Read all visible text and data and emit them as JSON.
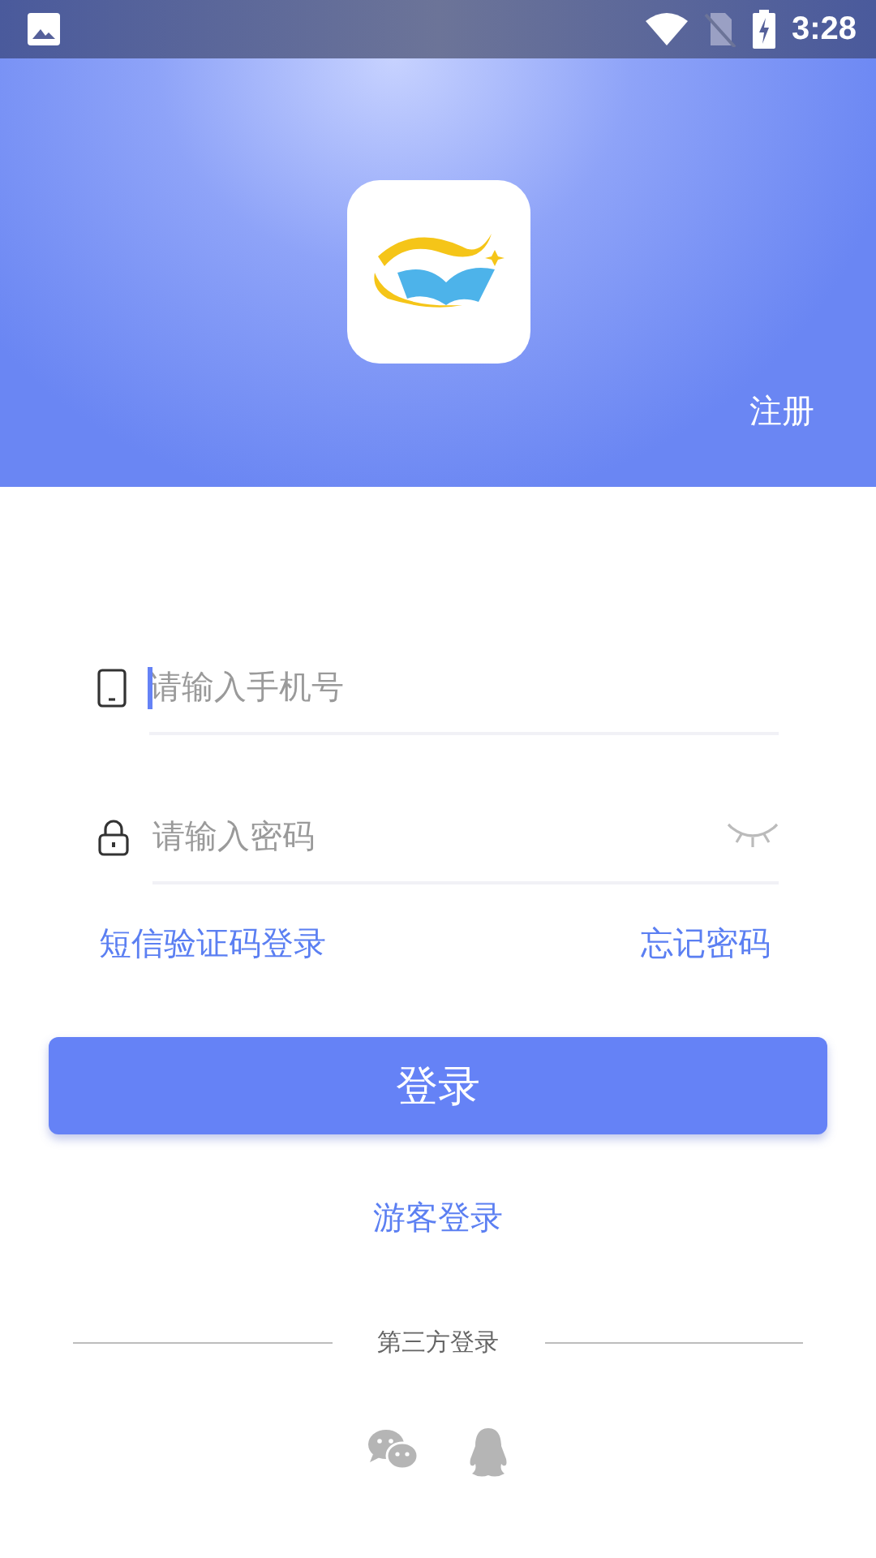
{
  "status_bar": {
    "time": "3:28"
  },
  "header": {
    "register_link": "注册"
  },
  "fields": [
    {
      "kind": "phone",
      "placeholder": "请输入手机号",
      "focused": true
    },
    {
      "kind": "password",
      "placeholder": "请输入密码",
      "focused": false,
      "password_visible": false
    }
  ],
  "links": {
    "sms_login": "短信验证码登录",
    "forgot_password": "忘记密码"
  },
  "login_button": "登录",
  "guest_login": "游客登录",
  "third_party": {
    "title": "第三方登录"
  }
}
